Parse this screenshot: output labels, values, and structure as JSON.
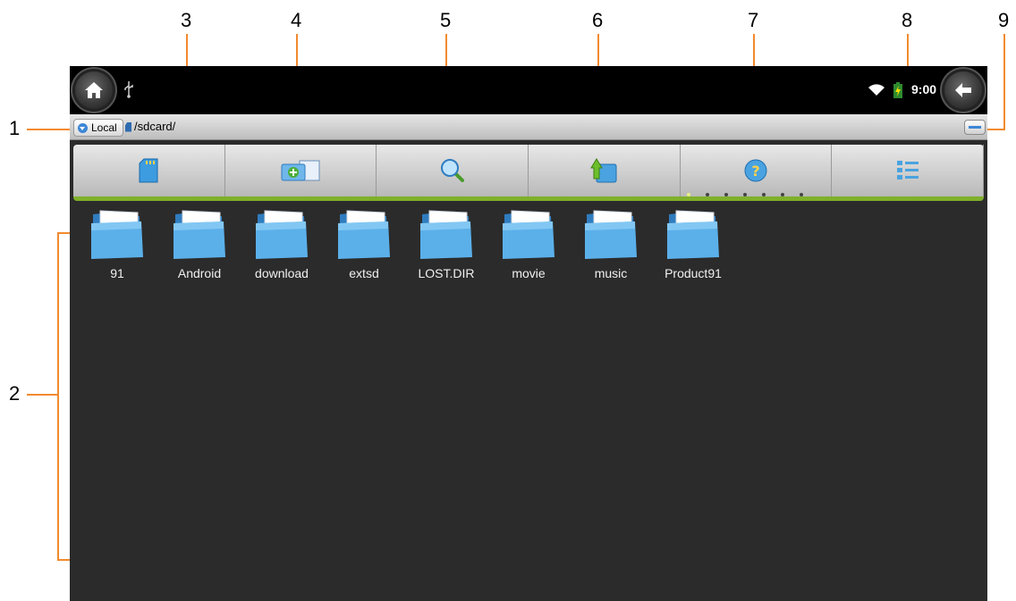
{
  "callouts": [
    "1",
    "2",
    "3",
    "4",
    "5",
    "6",
    "7",
    "8",
    "9"
  ],
  "status_bar": {
    "time": "9:00",
    "icons": [
      "home-icon",
      "usb-icon",
      "wifi-icon",
      "battery-icon",
      "back-icon"
    ]
  },
  "path_bar": {
    "location_label": "Local",
    "path": "/sdcard/"
  },
  "toolbar": {
    "buttons": [
      "sd-card-icon",
      "new-folder-icon",
      "search-icon",
      "up-folder-icon",
      "help-icon",
      "list-view-icon"
    ],
    "page_dots_total": 7,
    "page_dot_active": 1
  },
  "files": [
    {
      "name": "91",
      "icon": "folder-icon"
    },
    {
      "name": "Android",
      "icon": "folder-icon"
    },
    {
      "name": "download",
      "icon": "folder-icon"
    },
    {
      "name": "extsd",
      "icon": "folder-icon"
    },
    {
      "name": "LOST.DIR",
      "icon": "folder-icon"
    },
    {
      "name": "movie",
      "icon": "folder-icon"
    },
    {
      "name": "music",
      "icon": "folder-icon"
    },
    {
      "name": "Product91",
      "icon": "folder-icon"
    }
  ],
  "colors": {
    "callout_line": "#f28a2e",
    "toolbar_accent": "#7fb02a",
    "screen_bg": "#2b2b2b",
    "folder_blue": "#4aa3e0"
  }
}
